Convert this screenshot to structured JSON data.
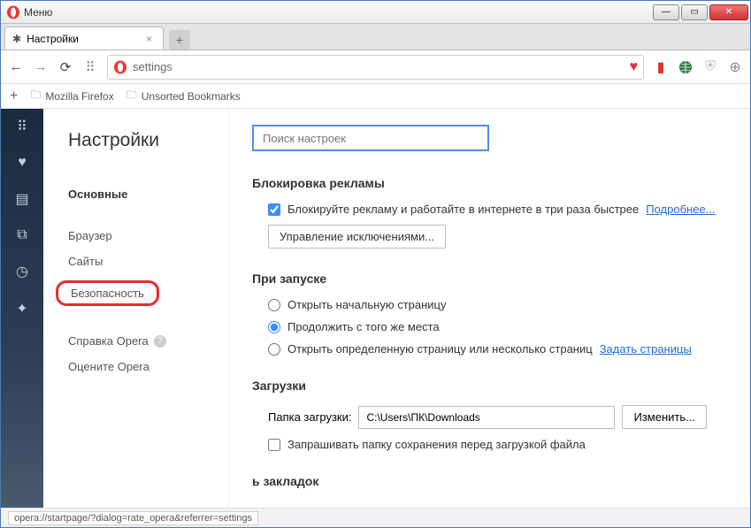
{
  "titlebar": {
    "menu": "Меню"
  },
  "tab": {
    "title": "Настройки"
  },
  "url": {
    "value": "settings"
  },
  "bookmarks": {
    "item1": "Mozilla Firefox",
    "item2": "Unsorted Bookmarks"
  },
  "sidebar": {
    "title": "Настройки",
    "main": "Основные",
    "browser": "Браузер",
    "sites": "Сайты",
    "security": "Безопасность",
    "help": "Справка Opera",
    "rate": "Оцените Opera"
  },
  "search": {
    "placeholder": "Поиск настроек"
  },
  "ads": {
    "title": "Блокировка рекламы",
    "checkbox": "Блокируйте рекламу и работайте в интернете в три раза быстрее",
    "more": "Подробнее...",
    "exceptions": "Управление исключениями..."
  },
  "startup": {
    "title": "При запуске",
    "opt1": "Открыть начальную страницу",
    "opt2": "Продолжить с того же места",
    "opt3": "Открыть определенную страницу или несколько страниц",
    "set": "Задать страницы"
  },
  "downloads": {
    "title": "Загрузки",
    "label": "Папка загрузки:",
    "path": "C:\\Users\\ПК\\Downloads",
    "change": "Изменить...",
    "ask": "Запрашивать папку сохранения перед загрузкой файла"
  },
  "bookmarks_bar": {
    "title": "ь закладок"
  },
  "status": {
    "url": "opera://startpage/?dialog=rate_opera&referrer=settings"
  }
}
